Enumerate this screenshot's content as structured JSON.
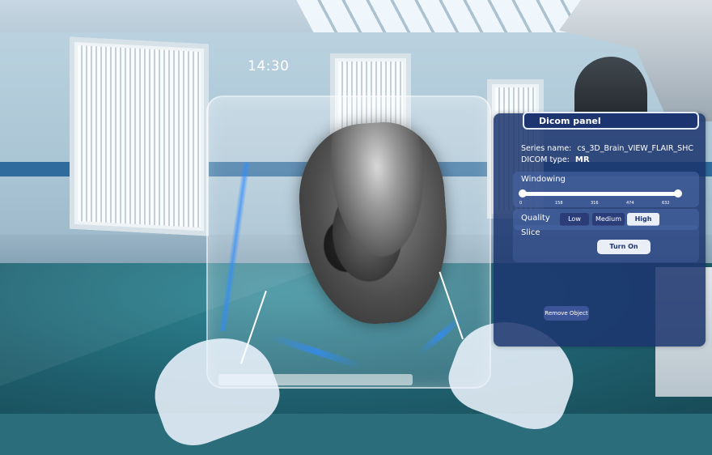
{
  "scene": {
    "clock": "14:30"
  },
  "dicom_panel": {
    "title": "Dicom panel",
    "series_label": "Series name:",
    "series_value": "cs_3D_Brain_VIEW_FLAIR_SHC",
    "type_label": "DICOM type:",
    "type_value": "MR",
    "windowing": {
      "label": "Windowing",
      "ticks": [
        "0",
        "158",
        "316",
        "474",
        "632"
      ],
      "min_value": 0,
      "max_value": 632,
      "range_max": 632,
      "min_label": "0",
      "max_label": "632"
    },
    "quality": {
      "label": "Quality",
      "options": [
        "Low",
        "Medium",
        "High"
      ],
      "selected": "High"
    },
    "slice": {
      "label": "Slice",
      "button": "Turn On"
    },
    "remove_button": "Remove Object"
  },
  "colors": {
    "panel_bg": "#1c346e",
    "stripe": "#2f6b9c",
    "hologram_beam": "#2f8cff"
  }
}
